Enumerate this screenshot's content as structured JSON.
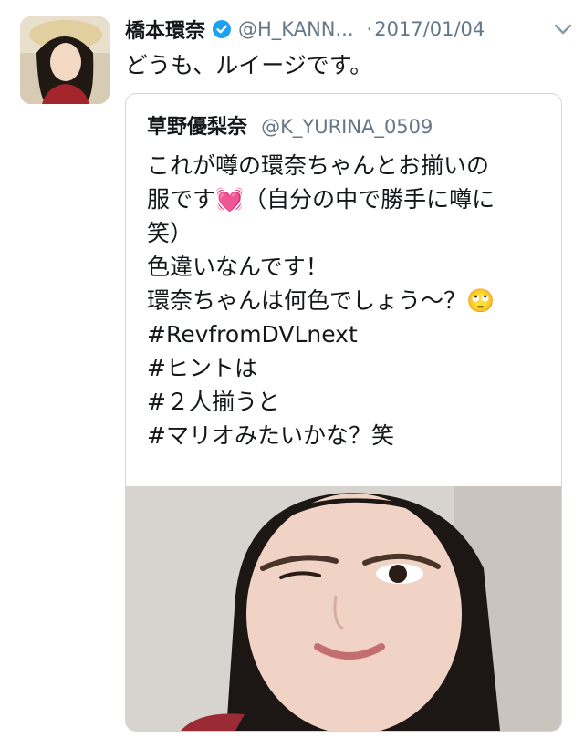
{
  "tweet": {
    "author_name": "橋本環奈",
    "author_handle": "@H_KANN...",
    "separator": "·",
    "date": "2017/01/04",
    "text": "どうも、ルイージです。",
    "verified": true,
    "icons": {
      "verified": "verified-badge-icon",
      "menu": "chevron-down-icon"
    }
  },
  "quote": {
    "author_name": "草野優梨奈",
    "author_handle": "@K_YURINA_0509",
    "lines": [
      "これが噂の環奈ちゃんとお揃いの",
      "服です💓（自分の中で勝手に噂に",
      "笑）",
      "色違いなんです！",
      "環奈ちゃんは何色でしょう〜？🙄",
      "#RevfromDVLnext",
      "#ヒントは",
      "#２人揃うと",
      "#マリオみたいかな？笑"
    ]
  },
  "colors": {
    "text": "#14171a",
    "secondary": "#657786",
    "verified_blue": "#1da1f2",
    "border": "#ccd6dd"
  }
}
